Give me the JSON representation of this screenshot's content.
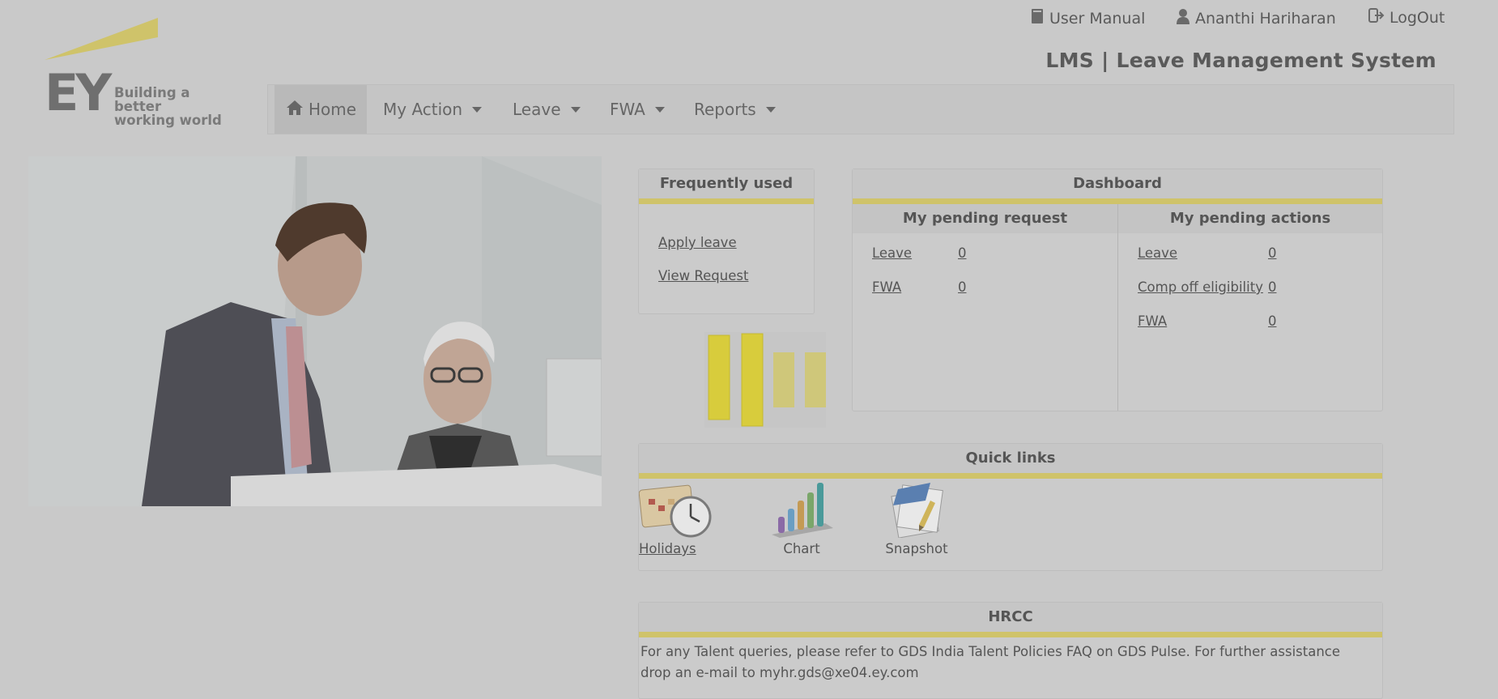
{
  "header": {
    "user_manual": "User Manual",
    "user_name": "Ananthi Hariharan",
    "logout": "LogOut",
    "app_title": "LMS | Leave Management System"
  },
  "logo": {
    "mark": "EY",
    "tagline_line1": "Building a better",
    "tagline_line2": "working world"
  },
  "nav": {
    "items": [
      {
        "label": "Home"
      },
      {
        "label": "My Action"
      },
      {
        "label": "Leave"
      },
      {
        "label": "FWA"
      },
      {
        "label": "Reports"
      }
    ]
  },
  "frequently_used": {
    "title": "Frequently used",
    "links": [
      "Apply leave",
      "View Request"
    ]
  },
  "dashboard": {
    "title": "Dashboard",
    "pending_request": {
      "title": "My pending request",
      "rows": [
        {
          "label": "Leave",
          "count": "0"
        },
        {
          "label": "FWA",
          "count": "0"
        }
      ]
    },
    "pending_actions": {
      "title": "My pending actions",
      "rows": [
        {
          "label": "Leave",
          "count": "0"
        },
        {
          "label": "Comp off eligibility",
          "count": "0"
        },
        {
          "label": "FWA",
          "count": "0"
        }
      ]
    }
  },
  "quick_links": {
    "title": "Quick links",
    "items": [
      {
        "label": "Holidays",
        "icon": "calendar-clock-icon"
      },
      {
        "label": "Chart",
        "icon": "bar-chart-icon"
      },
      {
        "label": "Snapshot",
        "icon": "document-pencil-icon"
      }
    ]
  },
  "hrcc": {
    "title": "HRCC",
    "text": "For any Talent queries, please refer to GDS India Talent Policies FAQ on GDS Pulse. For further assistance drop an e-mail to myhr.gds@xe04.ey.com"
  },
  "colors": {
    "accent_yellow": "#cfc36a",
    "page_bg": "#c9c9c9"
  }
}
